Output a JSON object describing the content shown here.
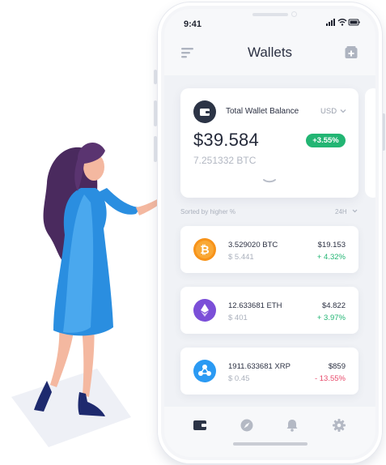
{
  "colors": {
    "positive": "#22b573",
    "negative": "#e84a6b",
    "bitcoin": "#f7931a",
    "ethereum": "#7b4fd8",
    "ripple": "#2b9af3",
    "dress": "#2a8ee0",
    "hair": "#4a2a5e"
  },
  "status_bar": {
    "time": "9:41"
  },
  "nav": {
    "title": "Wallets"
  },
  "balance_card": {
    "label": "Total Wallet Balance",
    "currency": "USD",
    "amount": "$39.584",
    "change": "+3.55%",
    "btc_equivalent": "7.251332 BTC"
  },
  "list_header": {
    "sort_label": "Sorted by higher %",
    "period": "24H"
  },
  "assets": [
    {
      "icon": "bitcoin-icon",
      "amount": "3.529020 BTC",
      "usd": "$ 5.441",
      "price": "$19.153",
      "change": "+ 4.32%",
      "trend": "up"
    },
    {
      "icon": "ethereum-icon",
      "amount": "12.633681 ETH",
      "usd": "$ 401",
      "price": "$4.822",
      "change": "+ 3.97%",
      "trend": "up"
    },
    {
      "icon": "ripple-icon",
      "amount": "1911.633681 XRP",
      "usd": "$ 0.45",
      "price": "$859",
      "change": "- 13.55%",
      "trend": "down"
    }
  ],
  "tab_bar": [
    "wallet-icon",
    "compass-icon",
    "bell-icon",
    "gear-icon"
  ]
}
